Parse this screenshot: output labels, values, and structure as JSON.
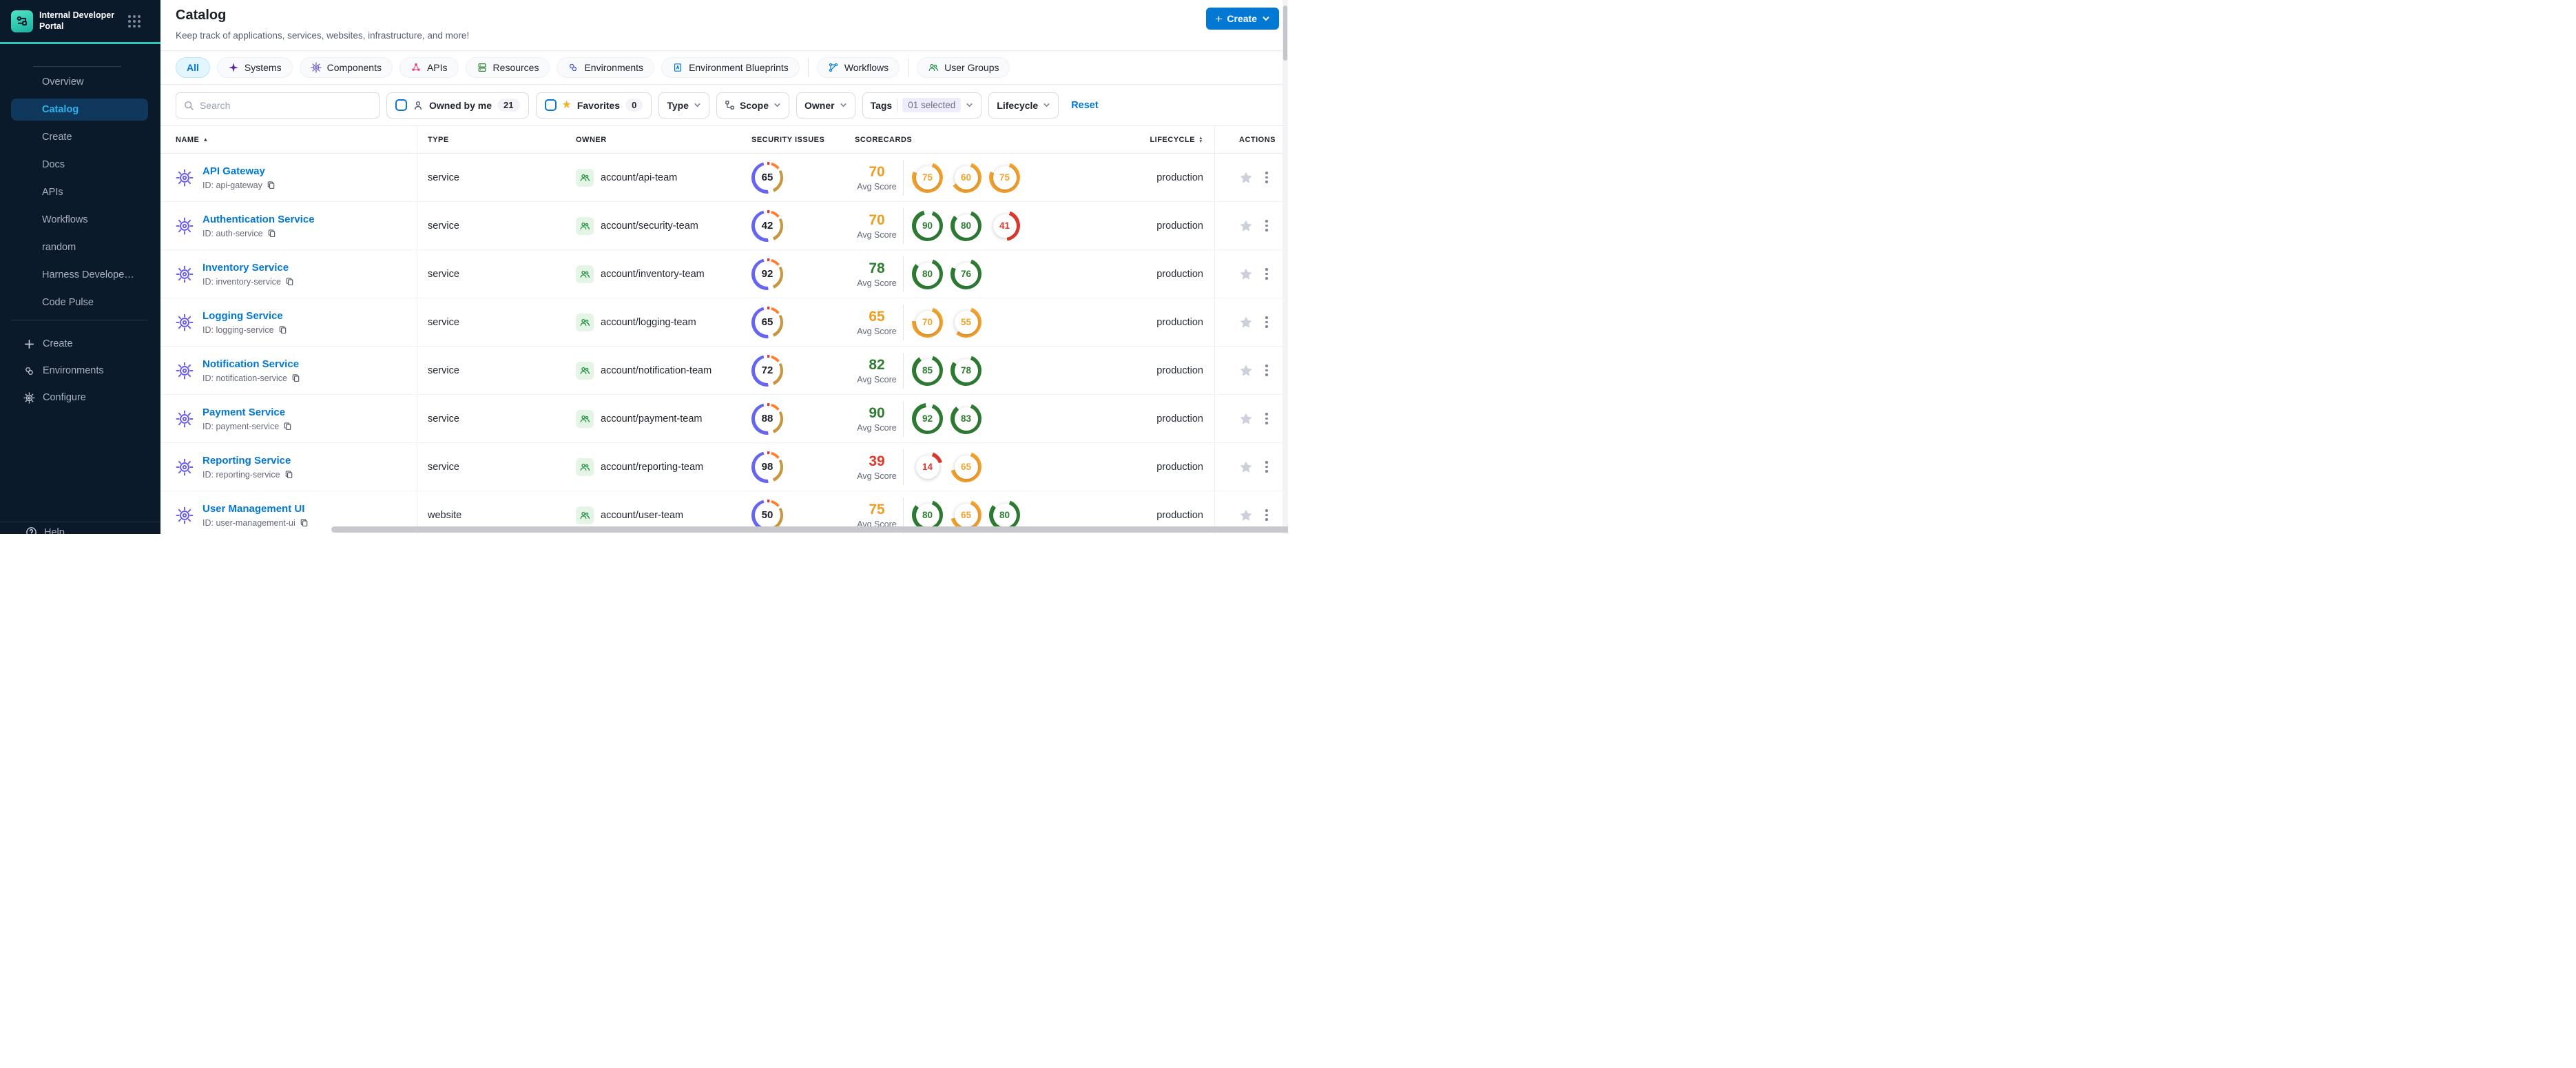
{
  "sidebar": {
    "brand_title": "Internal Developer Portal",
    "nav_items": [
      {
        "label": "Overview",
        "active": false
      },
      {
        "label": "Catalog",
        "active": true
      },
      {
        "label": "Create",
        "active": false
      },
      {
        "label": "Docs",
        "active": false
      },
      {
        "label": "APIs",
        "active": false
      },
      {
        "label": "Workflows",
        "active": false
      },
      {
        "label": "random",
        "active": false
      },
      {
        "label": "Harness Develope…",
        "active": false
      },
      {
        "label": "Code Pulse",
        "active": false
      }
    ],
    "bottom_items": [
      {
        "label": "Create",
        "icon": "plus-icon"
      },
      {
        "label": "Environments",
        "icon": "hexagons-icon"
      },
      {
        "label": "Configure",
        "icon": "gear-icon"
      }
    ],
    "help_label": "Help"
  },
  "header": {
    "title": "Catalog",
    "subtitle": "Keep track of applications, services, websites, infrastructure, and more!",
    "create_button": "Create"
  },
  "tabs": [
    {
      "label": "All",
      "icon": null,
      "color": null,
      "active": true,
      "divider_after": false
    },
    {
      "label": "Systems",
      "icon": "systems-icon",
      "color": "#5b2a9d",
      "active": false,
      "divider_after": false
    },
    {
      "label": "Components",
      "icon": "components-icon",
      "color": "#6a5acd",
      "active": false,
      "divider_after": false
    },
    {
      "label": "APIs",
      "icon": "apis-icon",
      "color": "#e5447e",
      "active": false,
      "divider_after": false
    },
    {
      "label": "Resources",
      "icon": "resources-icon",
      "color": "#2e7d32",
      "active": false,
      "divider_after": false
    },
    {
      "label": "Environments",
      "icon": "environments-icon",
      "color": "#4956e3",
      "active": false,
      "divider_after": false
    },
    {
      "label": "Environment Blueprints",
      "icon": "blueprints-icon",
      "color": "#0278d5",
      "active": false,
      "divider_after": true
    },
    {
      "label": "Workflows",
      "icon": "workflows-icon",
      "color": "#0278d5",
      "active": false,
      "divider_after": true
    },
    {
      "label": "User Groups",
      "icon": "user-groups-icon",
      "color": "#1e8e3e",
      "active": false,
      "divider_after": false
    }
  ],
  "filters": {
    "search_placeholder": "Search",
    "owned_by_me": {
      "label": "Owned by me",
      "count": "21"
    },
    "favorites": {
      "label": "Favorites",
      "count": "0"
    },
    "dropdowns": [
      {
        "label": "Type",
        "icon": null,
        "badge": null
      },
      {
        "label": "Scope",
        "icon": "scope-icon",
        "badge": null
      },
      {
        "label": "Owner",
        "icon": null,
        "badge": null
      },
      {
        "label": "Tags",
        "icon": null,
        "badge": "01 selected"
      },
      {
        "label": "Lifecycle",
        "icon": null,
        "badge": null
      }
    ],
    "reset_label": "Reset"
  },
  "table": {
    "columns": [
      {
        "label": "NAME",
        "sort": "asc"
      },
      {
        "label": "TYPE",
        "sort": null
      },
      {
        "label": "OWNER",
        "sort": null
      },
      {
        "label": "SECURITY ISSUES",
        "sort": null
      },
      {
        "label": "SCORECARDS",
        "sort": null
      },
      {
        "label": "LIFECYCLE",
        "sort": "both"
      },
      {
        "label": "ACTIONS",
        "sort": null
      }
    ],
    "avg_score_label": "Avg Score",
    "rows": [
      {
        "name": "API Gateway",
        "id_text": "ID: api-gateway",
        "type": "service",
        "owner": "account/api-team",
        "security_issues": "65",
        "avg_score": "70",
        "avg_color": "#ef9d20",
        "rings": [
          {
            "value": 75,
            "color": "#f5a32c"
          },
          {
            "value": 60,
            "color": "#f5a32c"
          },
          {
            "value": 75,
            "color": "#f5a32c"
          }
        ],
        "lifecycle": "production"
      },
      {
        "name": "Authentication Service",
        "id_text": "ID: auth-service",
        "type": "service",
        "owner": "account/security-team",
        "security_issues": "42",
        "avg_score": "70",
        "avg_color": "#ef9d20",
        "rings": [
          {
            "value": 90,
            "color": "#2e7d32"
          },
          {
            "value": 80,
            "color": "#2e7d32"
          },
          {
            "value": 41,
            "color": "#e0392d"
          }
        ],
        "lifecycle": "production"
      },
      {
        "name": "Inventory Service",
        "id_text": "ID: inventory-service",
        "type": "service",
        "owner": "account/inventory-team",
        "security_issues": "92",
        "avg_score": "78",
        "avg_color": "#2e7d32",
        "rings": [
          {
            "value": 80,
            "color": "#2e7d32"
          },
          {
            "value": 76,
            "color": "#2e7d32"
          }
        ],
        "lifecycle": "production"
      },
      {
        "name": "Logging Service",
        "id_text": "ID: logging-service",
        "type": "service",
        "owner": "account/logging-team",
        "security_issues": "65",
        "avg_score": "65",
        "avg_color": "#ef9d20",
        "rings": [
          {
            "value": 70,
            "color": "#f5a32c"
          },
          {
            "value": 55,
            "color": "#f5a32c"
          }
        ],
        "lifecycle": "production"
      },
      {
        "name": "Notification Service",
        "id_text": "ID: notification-service",
        "type": "service",
        "owner": "account/notification-team",
        "security_issues": "72",
        "avg_score": "82",
        "avg_color": "#2e7d32",
        "rings": [
          {
            "value": 85,
            "color": "#2e7d32"
          },
          {
            "value": 78,
            "color": "#2e7d32"
          }
        ],
        "lifecycle": "production"
      },
      {
        "name": "Payment Service",
        "id_text": "ID: payment-service",
        "type": "service",
        "owner": "account/payment-team",
        "security_issues": "88",
        "avg_score": "90",
        "avg_color": "#2e7d32",
        "rings": [
          {
            "value": 92,
            "color": "#2e7d32"
          },
          {
            "value": 83,
            "color": "#2e7d32"
          }
        ],
        "lifecycle": "production"
      },
      {
        "name": "Reporting Service",
        "id_text": "ID: reporting-service",
        "type": "service",
        "owner": "account/reporting-team",
        "security_issues": "98",
        "avg_score": "39",
        "avg_color": "#df382c",
        "rings": [
          {
            "value": 14,
            "color": "#e0392d"
          },
          {
            "value": 65,
            "color": "#f5a32c"
          }
        ],
        "lifecycle": "production"
      },
      {
        "name": "User Management UI",
        "id_text": "ID: user-management-ui",
        "type": "website",
        "owner": "account/user-team",
        "security_issues": "50",
        "avg_score": "75",
        "avg_color": "#ef9d20",
        "rings": [
          {
            "value": 80,
            "color": "#2e7d32"
          },
          {
            "value": 65,
            "color": "#f5a32c"
          },
          {
            "value": 80,
            "color": "#2e7d32"
          }
        ],
        "lifecycle": "production"
      }
    ]
  },
  "colors": {
    "accent_blue": "#0278d5",
    "sidebar_bg": "#0b1a2b",
    "sidebar_active_bg": "#10375c",
    "sidebar_active_text": "#2cb5f0",
    "teal_accent": "#2ec5b2",
    "entity_icon": "#6a5df5",
    "owner_icon_green": "#1e8e3e",
    "security_palette": {
      "blue": "#6565f1",
      "red": "#e0362a",
      "orange": "#ff7d2d",
      "amber": "#c8963e"
    }
  }
}
